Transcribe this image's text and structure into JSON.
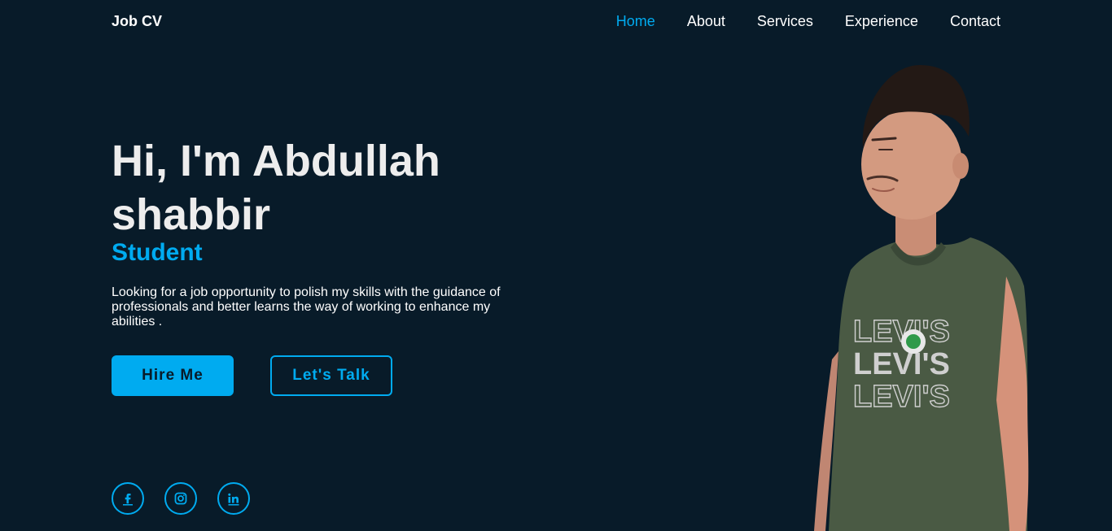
{
  "header": {
    "logo": "Job CV",
    "nav": [
      {
        "label": "Home",
        "active": true
      },
      {
        "label": "About",
        "active": false
      },
      {
        "label": "Services",
        "active": false
      },
      {
        "label": "Experience",
        "active": false
      },
      {
        "label": "Contact",
        "active": false
      }
    ]
  },
  "hero": {
    "title_line1": "Hi, I'm Abdullah",
    "title_line2": "shabbir",
    "subtitle": "Student",
    "description": "Looking for a job opportunity to polish my skills with the guidance of professionals and better learns the way of working to enhance my abilities ."
  },
  "buttons": {
    "primary": "Hire Me",
    "secondary": "Let's Talk"
  },
  "social": [
    {
      "icon": "facebook-icon"
    },
    {
      "icon": "instagram-icon"
    },
    {
      "icon": "linkedin-icon"
    }
  ],
  "portrait": {
    "shirt_text": "LEVI'S"
  },
  "colors": {
    "background": "#081b29",
    "accent": "#00abf0",
    "text": "#ededed"
  }
}
